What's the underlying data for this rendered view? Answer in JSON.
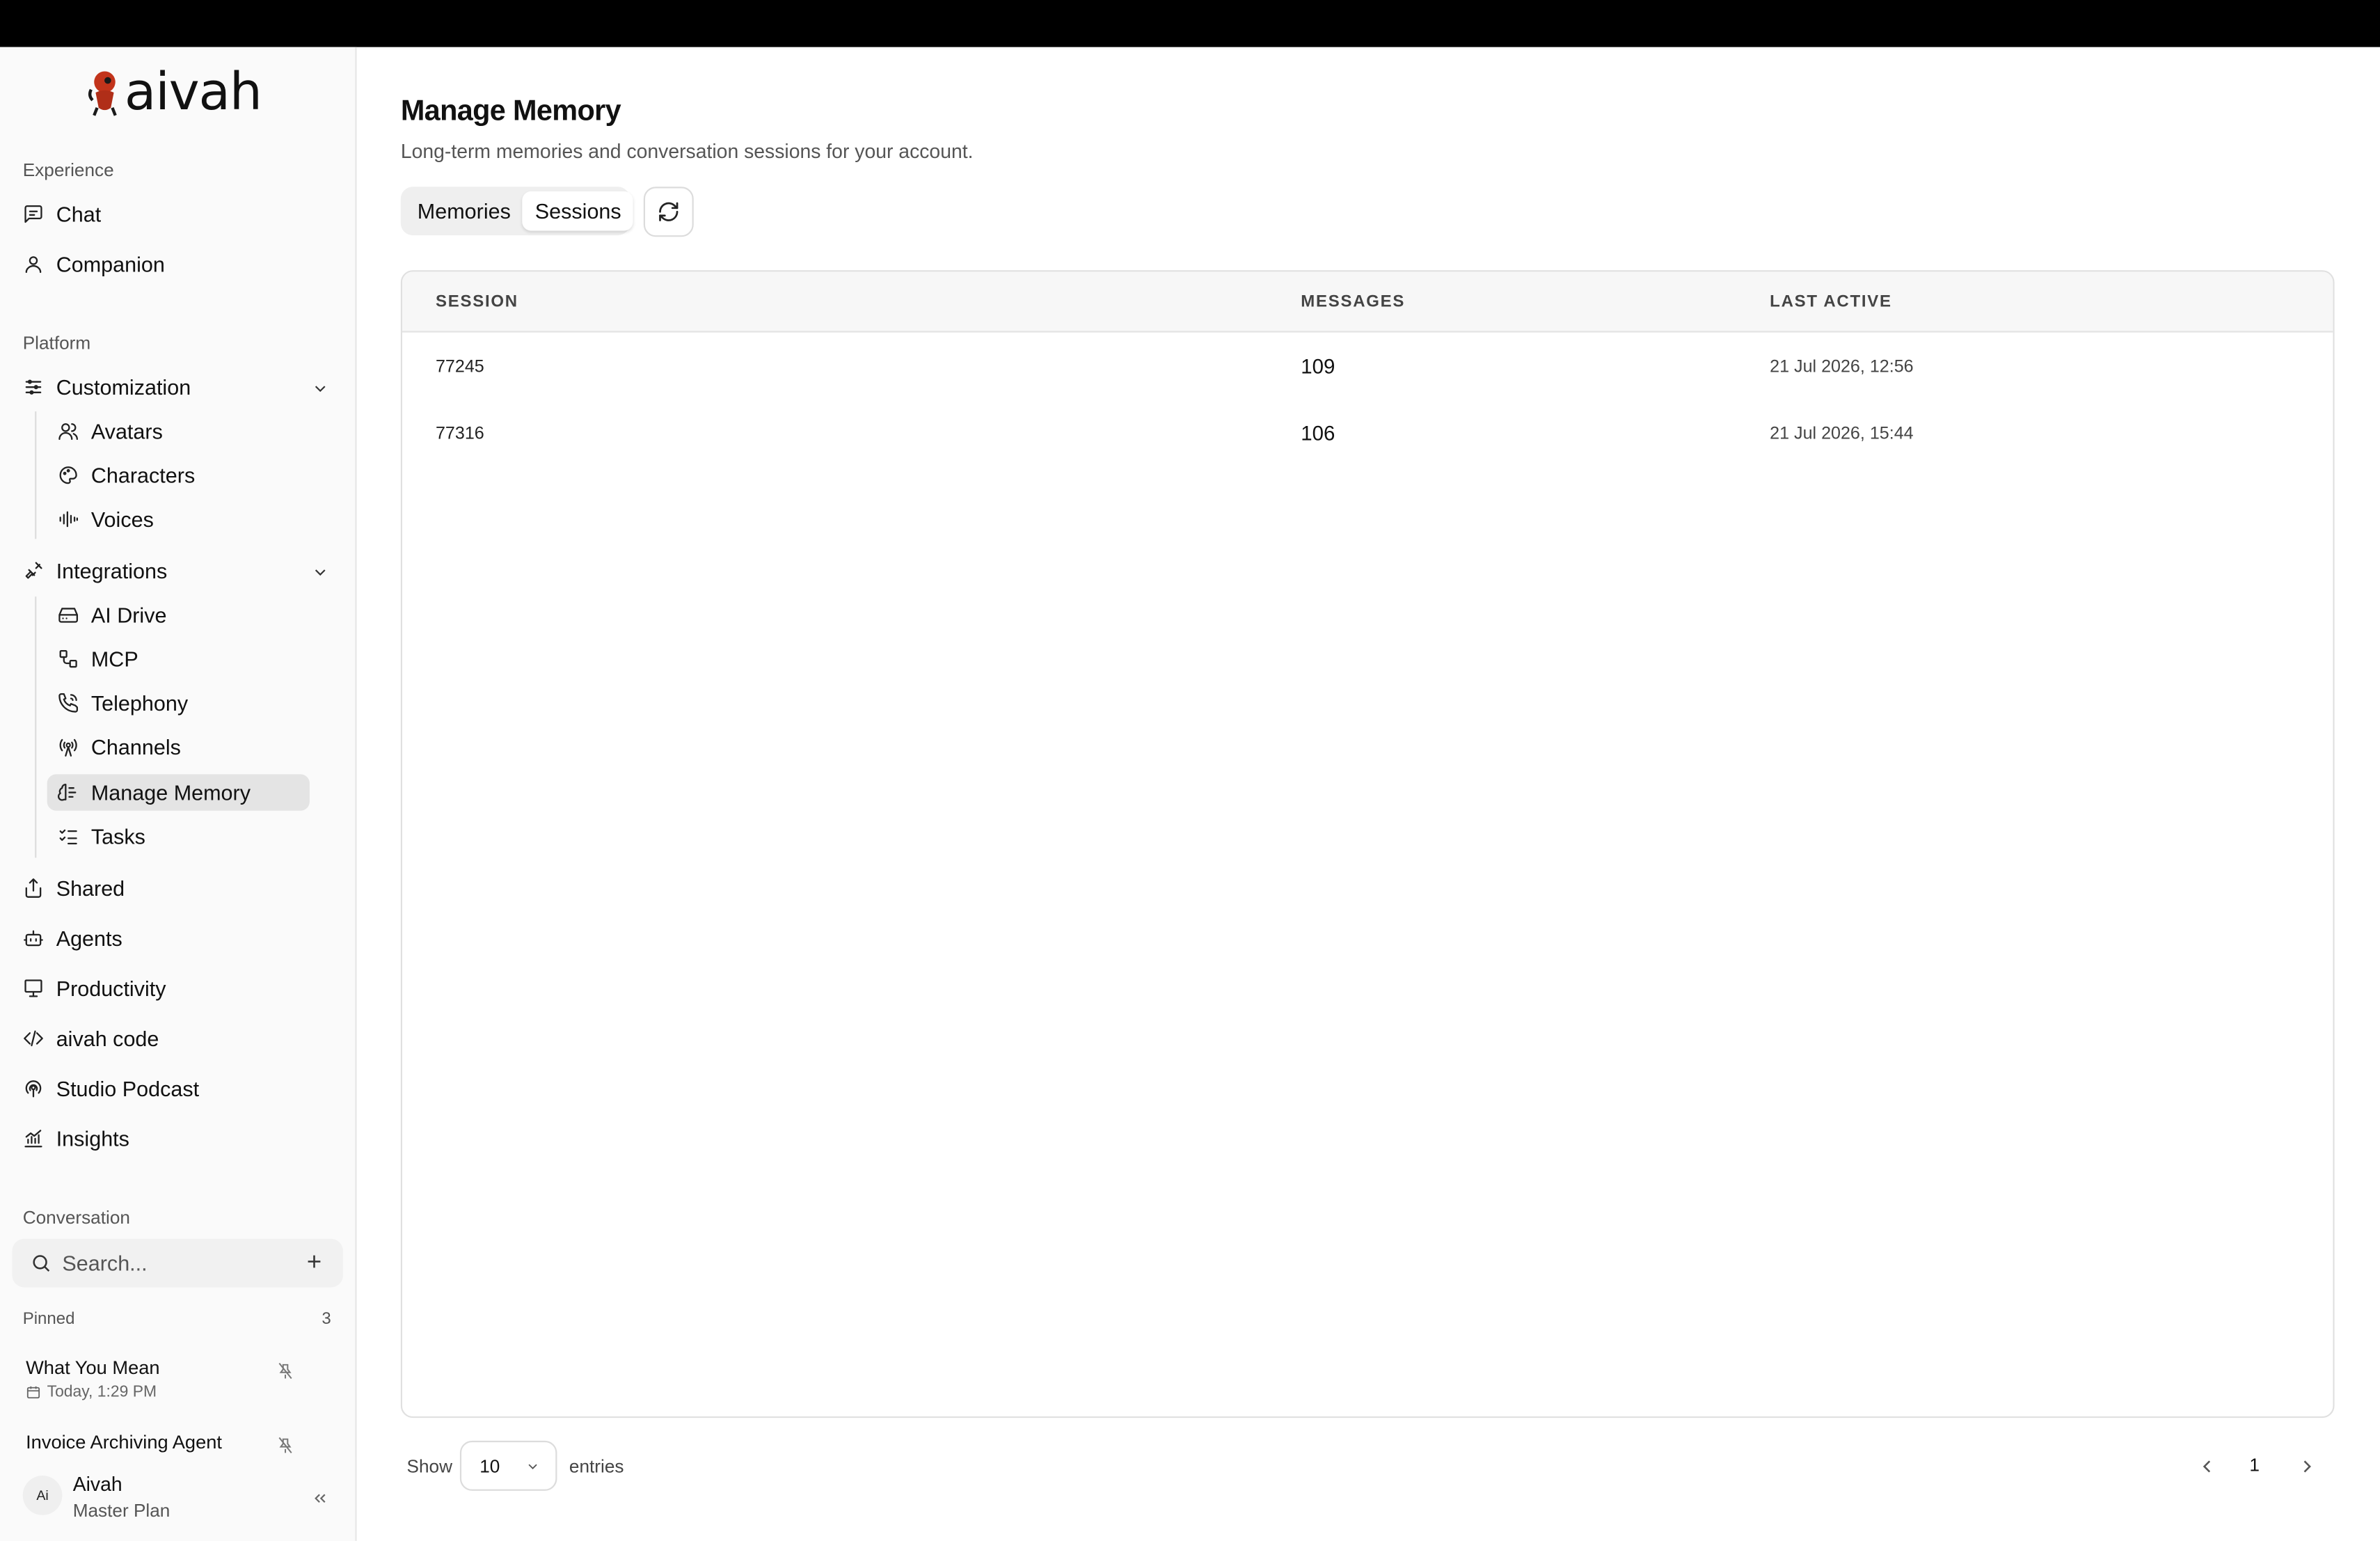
{
  "brand": {
    "name": "aivah",
    "accent": "#c2341b"
  },
  "sidebar": {
    "sections": {
      "experience": "Experience",
      "platform": "Platform",
      "conversation": "Conversation"
    },
    "experience_items": [
      {
        "label": "Chat",
        "icon": "message-square-icon"
      },
      {
        "label": "Companion",
        "icon": "user-icon"
      }
    ],
    "customization": {
      "label": "Customization",
      "items": [
        "Avatars",
        "Characters",
        "Voices"
      ]
    },
    "integrations": {
      "label": "Integrations",
      "items": [
        "AI Drive",
        "MCP",
        "Telephony",
        "Channels",
        "Manage Memory",
        "Tasks"
      ],
      "active": "Manage Memory"
    },
    "platform_items": [
      "Shared",
      "Agents",
      "Productivity",
      "aivah code",
      "Studio Podcast",
      "Insights"
    ],
    "search": {
      "placeholder": "Search..."
    },
    "pinned": {
      "label": "Pinned",
      "count": "3",
      "items": [
        {
          "title": "What You Mean",
          "date": "Today, 1:29 PM"
        },
        {
          "title": "Invoice Archiving Agent",
          "date": ""
        }
      ]
    },
    "user": {
      "initials": "Ai",
      "name": "Aivah",
      "plan": "Master Plan"
    }
  },
  "main": {
    "title": "Manage Memory",
    "subtitle": "Long-term memories and conversation sessions for your account.",
    "tabs": [
      {
        "label": "Memories",
        "active": false
      },
      {
        "label": "Sessions",
        "active": true
      }
    ],
    "table": {
      "headers": [
        "SESSION",
        "MESSAGES",
        "LAST ACTIVE"
      ],
      "rows": [
        {
          "session": "77245",
          "messages": "109",
          "last_active": "21 Jul 2026, 12:56"
        },
        {
          "session": "77316",
          "messages": "106",
          "last_active": "21 Jul 2026, 15:44"
        }
      ]
    },
    "footer": {
      "show_label": "Show",
      "page_size": "10",
      "entries_label": "entries",
      "current_page": "1"
    }
  }
}
